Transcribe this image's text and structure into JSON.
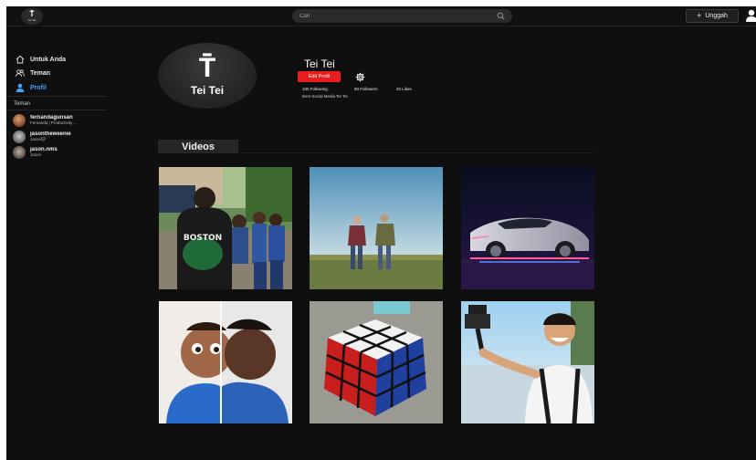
{
  "brand": {
    "glyph": "Ṫ̈",
    "name": "Tei Tei"
  },
  "topbar": {
    "search_placeholder": "Cari",
    "upload_label": "Unggah"
  },
  "sidebar": {
    "nav": [
      {
        "label": "Untuk Anda",
        "icon": "home-icon"
      },
      {
        "label": "Teman",
        "icon": "friends-icon"
      },
      {
        "label": "Profil",
        "icon": "user-icon",
        "active": true
      }
    ],
    "section_label": "Teman",
    "friends": [
      {
        "name": "fernandagunsan",
        "sub": "Fernanda | Productivity ..."
      },
      {
        "name": "jasontheweenie",
        "sub": "Jason🐱"
      },
      {
        "name": "jason.nms",
        "sub": "Jason"
      }
    ]
  },
  "profile": {
    "name": "Tei Tei",
    "edit_label": "Edit Profil",
    "following": "100 Following",
    "followers": "50 Followers",
    "likes": "20 Likes",
    "bio": "Best Social Media Tei Tei"
  },
  "videos_tab": "Videos",
  "videos": [
    {
      "subject": "boys in school uniform, Boston jacket"
    },
    {
      "subject": "two men walking on grass under sky"
    },
    {
      "subject": "futuristic sports car with neon lights"
    },
    {
      "subject": "split face cartoon and real portrait"
    },
    {
      "subject": "rubik's cube on table"
    },
    {
      "subject": "smiling man with camera on selfie stick"
    }
  ],
  "colors": {
    "accent": "#3ea6ff",
    "edit_button": "#e81e1e",
    "background": "#0f0f0f"
  }
}
